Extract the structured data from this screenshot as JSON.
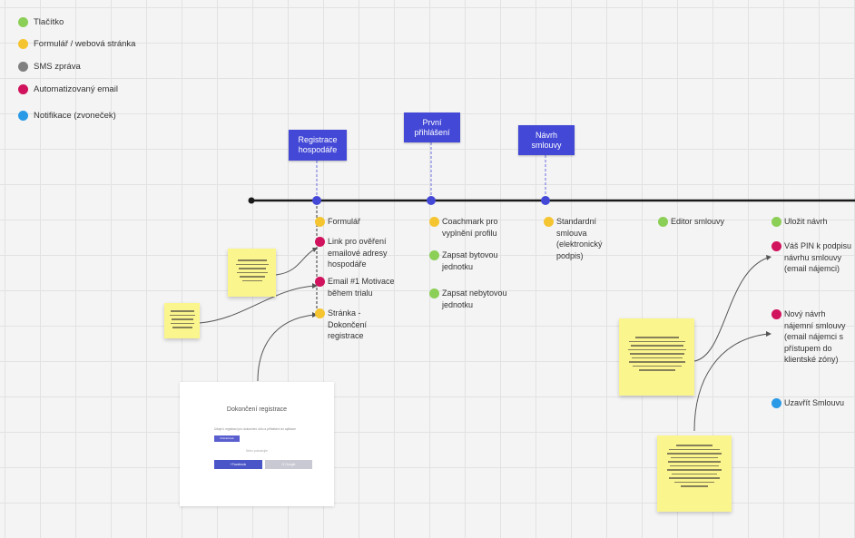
{
  "colors": {
    "button": "#8ccf57",
    "form": "#f5c431",
    "sms": "#808080",
    "email": "#d1125c",
    "notification": "#2b9ae6",
    "tag": "#4348d6",
    "sticky": "#fbf58d"
  },
  "legend": [
    {
      "label": "Tlačítko",
      "color": "#8ccf57"
    },
    {
      "label": "Formulář / webová stránka",
      "color": "#f5c431"
    },
    {
      "label": "SMS zpráva",
      "color": "#808080"
    },
    {
      "label": "Automatizovaný email",
      "color": "#d1125c"
    },
    {
      "label": "Notifikace (zvoneček)",
      "color": "#2b9ae6"
    }
  ],
  "milestones": [
    {
      "label": "Registrace hospodáře"
    },
    {
      "label": "První přihlášení"
    },
    {
      "label": "Návrh smlouvy"
    }
  ],
  "steps": {
    "registration": [
      {
        "label": "Formulář",
        "type": "form"
      },
      {
        "label": "Link pro ověření emailové adresy hospodáře",
        "type": "email"
      },
      {
        "label": "Email #1 Motivace během trialu",
        "type": "email"
      },
      {
        "label": "Stránka - Dokončení registrace",
        "type": "form"
      }
    ],
    "first_login": [
      {
        "label": "Coachmark pro vyplnění profilu",
        "type": "form"
      },
      {
        "label": "Zapsat bytovou jednotku",
        "type": "button"
      },
      {
        "label": "Zapsat nebytovou jednotku",
        "type": "button"
      }
    ],
    "contract": [
      {
        "label": "Standardní smlouva (elektronický podpis)",
        "type": "form"
      }
    ],
    "editor": [
      {
        "label": "Editor smlouvy",
        "type": "button"
      }
    ],
    "save": [
      {
        "label": "Uložit návrh",
        "type": "button"
      },
      {
        "label": "Váš PIN k podpisu návrhu smlouvy (email nájemci)",
        "type": "email"
      },
      {
        "label": "Nový návrh nájemní smlouvy (email nájemci s přístupem do klientské zóny)",
        "type": "email"
      },
      {
        "label": "Uzavřít Smlouvu",
        "type": "notification"
      }
    ]
  },
  "mockup": {
    "title": "Dokončení registrace",
    "text": "Údaje k registraci pro dokončení účtu a přihlášení do aplikace",
    "primary_button": "Pokračovat",
    "divider": "Nebo pokračujte",
    "facebook_button": "f  Facebook",
    "google_button": "G  Google"
  }
}
